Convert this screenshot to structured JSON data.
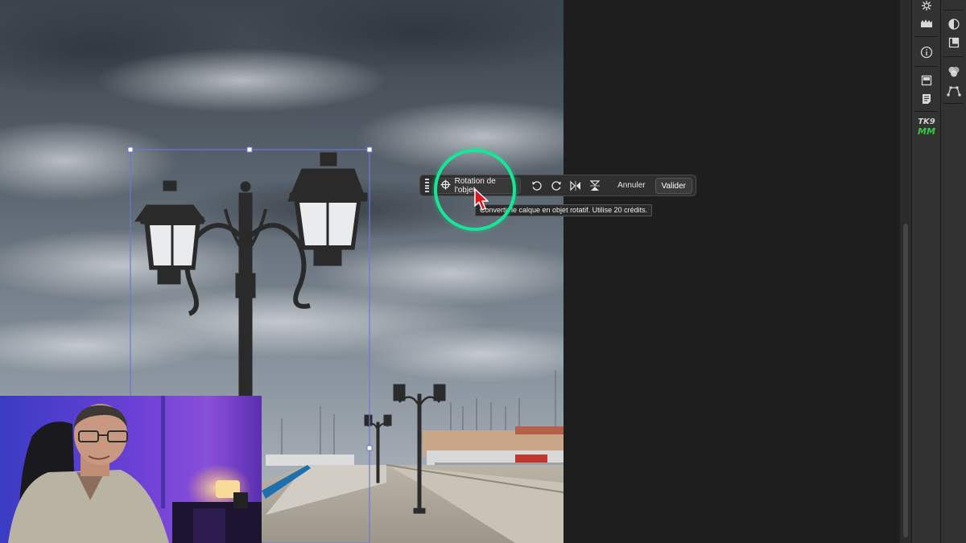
{
  "taskbar": {
    "rotate_label": "Rotation de l'objet",
    "cancel_label": "Annuler",
    "validate_label": "Valider"
  },
  "tooltip": {
    "text": "Convertir le calque en objet rotatif. Utilise 20 crédits."
  },
  "panel": {
    "badge_line1": "TK9",
    "badge_line2": "MM"
  },
  "icons": {
    "rotate": "rotate-object-icon",
    "rotate_left": "rotate-left-icon",
    "rotate_right": "rotate-right-icon",
    "flip_horizontal": "flip-horizontal-icon",
    "flip_vertical": "flip-vertical-icon"
  },
  "colors": {
    "highlight": "#14e898",
    "selection": "#6a78d8",
    "cursor": "#e0141c",
    "workspace": "#1e1e1e"
  }
}
